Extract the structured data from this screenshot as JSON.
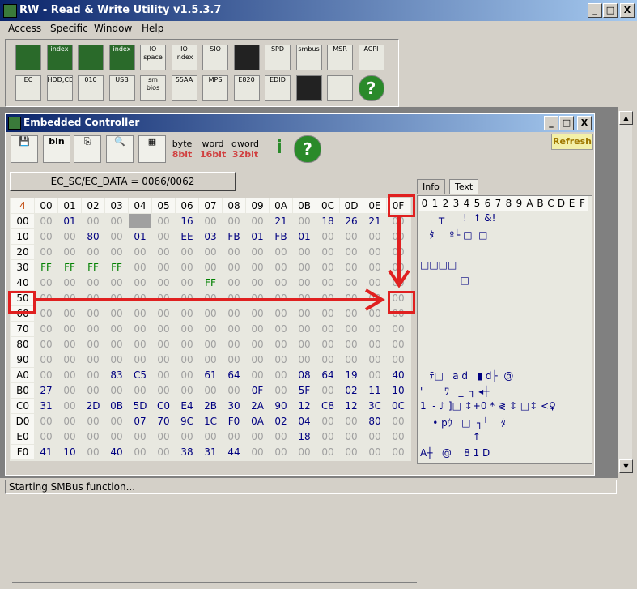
{
  "window": {
    "title": "RW - Read & Write Utility v1.5.3.7",
    "min": "_",
    "max": "□",
    "close": "X"
  },
  "menu": [
    "Access",
    "Specific",
    "Window",
    "Help"
  ],
  "toolbar_row1": [
    "",
    "index",
    "",
    "index",
    "IO space",
    "IO index",
    "SIO",
    "",
    "SPD",
    "smbus",
    "MSR",
    "ACPI"
  ],
  "toolbar_row2": [
    "EC",
    "HDD,CD",
    "010",
    "USB",
    "sm bios",
    "55AA",
    "MPS",
    "E820",
    "EDID",
    "",
    "",
    "?"
  ],
  "ec": {
    "title": "Embedded Controller",
    "address_label": "EC_SC/EC_DATA = 0066/0062",
    "refresh_label": "Refresh",
    "byte": "byte",
    "byte_bits": "8bit",
    "word": "word",
    "word_bits": "16bit",
    "dword": "dword",
    "dword_bits": "32bit",
    "info_icon": "i",
    "help_icon": "?",
    "tab_info": "Info",
    "tab_text": "Text"
  },
  "grid": {
    "corner": "4",
    "col_headers": [
      "00",
      "01",
      "02",
      "03",
      "04",
      "05",
      "06",
      "07",
      "08",
      "09",
      "0A",
      "0B",
      "0C",
      "0D",
      "0E",
      "0F"
    ],
    "rows": [
      {
        "addr": "00",
        "cells": [
          "00",
          "01",
          "00",
          "00",
          "00",
          "00",
          "16",
          "00",
          "00",
          "00",
          "21",
          "00",
          "18",
          "26",
          "21",
          "00"
        ]
      },
      {
        "addr": "10",
        "cells": [
          "00",
          "00",
          "80",
          "00",
          "01",
          "00",
          "EE",
          "03",
          "FB",
          "01",
          "FB",
          "01",
          "00",
          "00",
          "00",
          "00"
        ]
      },
      {
        "addr": "20",
        "cells": [
          "00",
          "00",
          "00",
          "00",
          "00",
          "00",
          "00",
          "00",
          "00",
          "00",
          "00",
          "00",
          "00",
          "00",
          "00",
          "00"
        ]
      },
      {
        "addr": "30",
        "cells": [
          "FF",
          "FF",
          "FF",
          "FF",
          "00",
          "00",
          "00",
          "00",
          "00",
          "00",
          "00",
          "00",
          "00",
          "00",
          "00",
          "00"
        ]
      },
      {
        "addr": "40",
        "cells": [
          "00",
          "00",
          "00",
          "00",
          "00",
          "00",
          "00",
          "FF",
          "00",
          "00",
          "00",
          "00",
          "00",
          "00",
          "00",
          "00"
        ]
      },
      {
        "addr": "50",
        "cells": [
          "00",
          "00",
          "00",
          "00",
          "00",
          "00",
          "00",
          "00",
          "00",
          "00",
          "00",
          "00",
          "00",
          "00",
          "00",
          "00"
        ]
      },
      {
        "addr": "60",
        "cells": [
          "00",
          "00",
          "00",
          "00",
          "00",
          "00",
          "00",
          "00",
          "00",
          "00",
          "00",
          "00",
          "00",
          "00",
          "00",
          "00"
        ]
      },
      {
        "addr": "70",
        "cells": [
          "00",
          "00",
          "00",
          "00",
          "00",
          "00",
          "00",
          "00",
          "00",
          "00",
          "00",
          "00",
          "00",
          "00",
          "00",
          "00"
        ]
      },
      {
        "addr": "80",
        "cells": [
          "00",
          "00",
          "00",
          "00",
          "00",
          "00",
          "00",
          "00",
          "00",
          "00",
          "00",
          "00",
          "00",
          "00",
          "00",
          "00"
        ]
      },
      {
        "addr": "90",
        "cells": [
          "00",
          "00",
          "00",
          "00",
          "00",
          "00",
          "00",
          "00",
          "00",
          "00",
          "00",
          "00",
          "00",
          "00",
          "00",
          "00"
        ]
      },
      {
        "addr": "A0",
        "cells": [
          "00",
          "00",
          "00",
          "83",
          "C5",
          "00",
          "00",
          "61",
          "64",
          "00",
          "00",
          "08",
          "64",
          "19",
          "00",
          "40"
        ]
      },
      {
        "addr": "B0",
        "cells": [
          "27",
          "00",
          "00",
          "00",
          "00",
          "00",
          "00",
          "00",
          "00",
          "0F",
          "00",
          "5F",
          "00",
          "02",
          "11",
          "10"
        ]
      },
      {
        "addr": "C0",
        "cells": [
          "31",
          "00",
          "2D",
          "0B",
          "5D",
          "C0",
          "E4",
          "2B",
          "30",
          "2A",
          "90",
          "12",
          "C8",
          "12",
          "3C",
          "0C"
        ]
      },
      {
        "addr": "D0",
        "cells": [
          "00",
          "00",
          "00",
          "00",
          "07",
          "70",
          "9C",
          "1C",
          "F0",
          "0A",
          "02",
          "04",
          "00",
          "00",
          "80",
          "00"
        ]
      },
      {
        "addr": "E0",
        "cells": [
          "00",
          "00",
          "00",
          "00",
          "00",
          "00",
          "00",
          "00",
          "00",
          "00",
          "00",
          "18",
          "00",
          "00",
          "00",
          "00"
        ]
      },
      {
        "addr": "F0",
        "cells": [
          "41",
          "10",
          "00",
          "40",
          "00",
          "00",
          "38",
          "31",
          "44",
          "00",
          "00",
          "00",
          "00",
          "00",
          "00",
          "00"
        ]
      }
    ]
  },
  "text_panel": {
    "col_headers": [
      "0",
      "1",
      "2",
      "3",
      "4",
      "5",
      "6",
      "7",
      "8",
      "9",
      "A",
      "B",
      "C",
      "D",
      "E",
      "F"
    ],
    "lines": [
      {
        "row": 0,
        "text": "      ┬      !  ↑ &!"
      },
      {
        "row": 1,
        "text": "   ﾀ     º└ □  □"
      },
      {
        "row": 3,
        "text": "□□□□"
      },
      {
        "row": 4,
        "text": "             □"
      },
      {
        "row": 10,
        "text": "   ﾃ□   a d   ▮ d├  @"
      },
      {
        "row": 11,
        "text": "'       ﾜ   _  ┐ ◂┼"
      },
      {
        "row": 12,
        "text": "1  - ♪ ]□ ↕+0 * ≷ ↕ □↕ <♀"
      },
      {
        "row": 13,
        "text": "    • pｳ   □  ┐╵    ﾀ"
      },
      {
        "row": 14,
        "text": "                 ↑"
      },
      {
        "row": 15,
        "text": "A┼   @    8 1 D"
      }
    ]
  },
  "status": "Starting SMBus function..."
}
